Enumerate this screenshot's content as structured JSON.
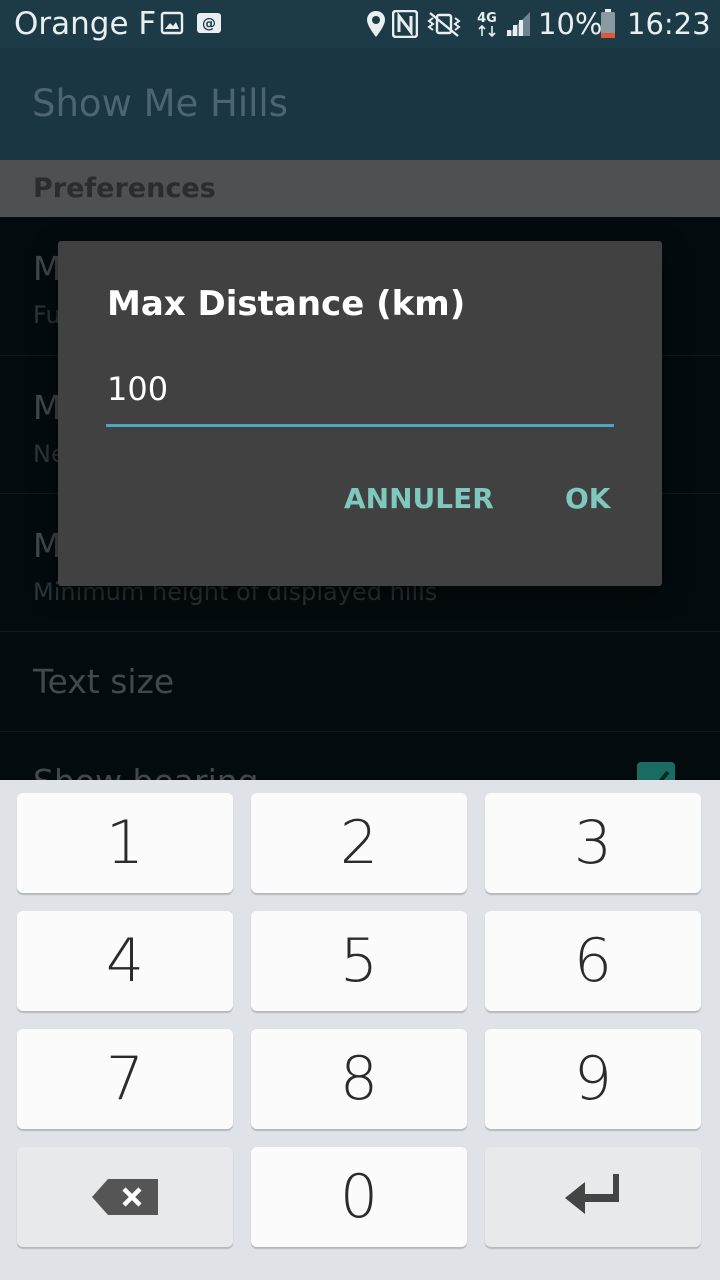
{
  "status_bar": {
    "carrier": "Orange F",
    "battery_percent": "10%",
    "time": "16:23",
    "icons": [
      "image-icon",
      "at-icon",
      "location-icon",
      "nfc-icon",
      "vibrate-icon",
      "4g-icon",
      "signal-icon",
      "battery-icon"
    ]
  },
  "app_bar": {
    "title": "Show Me Hills"
  },
  "preferences": {
    "header": "Preferences",
    "rows": [
      {
        "title": "M",
        "subtitle": "Fu"
      },
      {
        "title": "M",
        "subtitle": "Ne"
      },
      {
        "title": "M",
        "subtitle": "Minimum height of displayed hills"
      },
      {
        "title": "Text size",
        "subtitle": ""
      },
      {
        "title": "Show bearing",
        "subtitle": ""
      }
    ],
    "checkbox_checked": true
  },
  "dialog": {
    "title": "Max Distance (km)",
    "value": "100",
    "cancel_label": "ANNULER",
    "ok_label": "OK"
  },
  "keyboard": {
    "keys": [
      "1",
      "2",
      "3",
      "4",
      "5",
      "6",
      "7",
      "8",
      "9",
      "",
      "0",
      ""
    ],
    "special": {
      "backspace": "backspace-icon",
      "enter": "enter-icon"
    }
  },
  "colors": {
    "accent": "#4aa7c4",
    "dialog_button": "#7ec8bd",
    "app_bar": "#1a3642"
  }
}
